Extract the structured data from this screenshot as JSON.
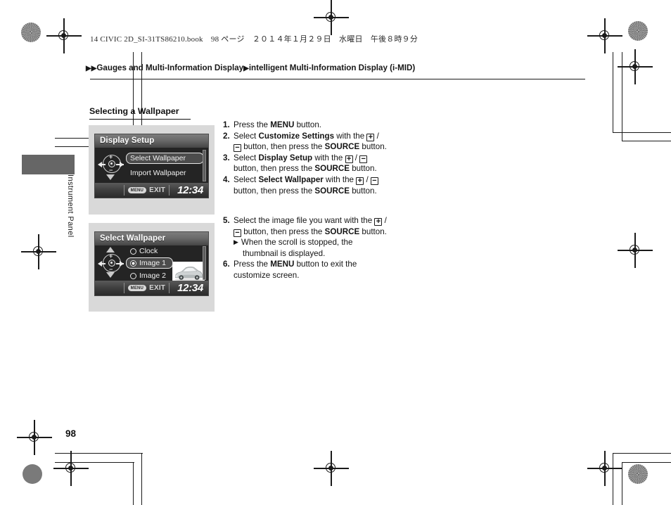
{
  "page": {
    "running_head": "14 CIVIC 2D_SI-31TS86210.book　98 ページ　２０１４年１月２９日　水曜日　午後８時９分",
    "folio": "98",
    "side_tab_label": "Instrument Panel"
  },
  "breadcrumb": {
    "marker": "▶",
    "level1": "Gauges and Multi-Information Display",
    "level2": "intelligent Multi-Information Display (i-MID)"
  },
  "section": {
    "title": "Selecting a Wallpaper"
  },
  "figures": [
    {
      "name": "display-setup-screen",
      "title": "Display Setup",
      "rows": [
        {
          "label": "Select Wallpaper",
          "selected": true,
          "radio": false
        },
        {
          "label": "Import Wallpaper",
          "selected": false,
          "radio": false
        }
      ],
      "statusbar": {
        "menu_key": "MENU",
        "exit_label": "EXIT",
        "clock": "12:34"
      },
      "knob": {
        "plus": "+",
        "minus": "−"
      },
      "has_thumbnail": false,
      "scroll_up": false,
      "scroll_down": true
    },
    {
      "name": "select-wallpaper-screen",
      "title": "Select Wallpaper",
      "rows": [
        {
          "label": "Clock",
          "selected": false,
          "radio": true,
          "radio_on": false
        },
        {
          "label": "Image 1",
          "selected": true,
          "radio": true,
          "radio_on": true
        },
        {
          "label": "Image 2",
          "selected": false,
          "radio": true,
          "radio_on": false
        }
      ],
      "statusbar": {
        "menu_key": "MENU",
        "exit_label": "EXIT",
        "clock": "12:34"
      },
      "knob": {
        "plus": "+",
        "minus": "−"
      },
      "has_thumbnail": true,
      "thumbnail_alt": "car-wallpaper-thumbnail",
      "scroll_up": true,
      "scroll_down": true
    }
  ],
  "procedure_top": [
    {
      "num": "1.",
      "parts": [
        {
          "t": "Press the "
        },
        {
          "t": "MENU",
          "b": true
        },
        {
          "t": " button."
        }
      ]
    },
    {
      "num": "2.",
      "parts": [
        {
          "t": "Select "
        },
        {
          "t": "Customize Settings",
          "b": true
        },
        {
          "t": " with the "
        },
        {
          "k": "+"
        },
        {
          "t": " / "
        }
      ]
    },
    {
      "num": "",
      "parts": [
        {
          "k": "−"
        },
        {
          "t": " button, then press the "
        },
        {
          "t": "SOURCE",
          "b": true
        },
        {
          "t": " button."
        }
      ],
      "indent": true
    },
    {
      "num": "3.",
      "parts": [
        {
          "t": "Select "
        },
        {
          "t": "Display Setup",
          "b": true
        },
        {
          "t": " with the "
        },
        {
          "k": "+"
        },
        {
          "t": " / "
        },
        {
          "k": "−"
        }
      ]
    },
    {
      "num": "",
      "parts": [
        {
          "t": "button, then press the "
        },
        {
          "t": "SOURCE",
          "b": true
        },
        {
          "t": " button."
        }
      ],
      "indent": true
    },
    {
      "num": "4.",
      "parts": [
        {
          "t": "Select "
        },
        {
          "t": "Select Wallpaper",
          "b": true
        },
        {
          "t": " with the "
        },
        {
          "k": "+"
        },
        {
          "t": " / "
        },
        {
          "k": "−"
        }
      ]
    },
    {
      "num": "",
      "parts": [
        {
          "t": "button, then press the "
        },
        {
          "t": "SOURCE",
          "b": true
        },
        {
          "t": " button."
        }
      ],
      "indent": true
    }
  ],
  "procedure_bottom": [
    {
      "num": "5.",
      "parts": [
        {
          "t": "Select the image file you want with the "
        },
        {
          "k": "+"
        },
        {
          "t": " / "
        }
      ]
    },
    {
      "num": "",
      "parts": [
        {
          "k": "−"
        },
        {
          "t": " button, then press the "
        },
        {
          "t": "SOURCE",
          "b": true
        },
        {
          "t": " button."
        }
      ],
      "indent": true
    },
    {
      "num": "",
      "bullet": "▶",
      "parts": [
        {
          "t": "When the scroll is stopped, the"
        }
      ]
    },
    {
      "num": "",
      "parts": [
        {
          "t": "thumbnail is displayed."
        }
      ],
      "indent2": true
    },
    {
      "num": "6.",
      "parts": [
        {
          "t": "Press the "
        },
        {
          "t": "MENU",
          "b": true
        },
        {
          "t": " button to exit the"
        }
      ]
    },
    {
      "num": "",
      "parts": [
        {
          "t": "customize screen."
        }
      ],
      "indent": true
    }
  ],
  "colors": {
    "page_bg": "#ffffff",
    "ink": "#1a1a1a",
    "figure_bg": "#d9d9d9",
    "screen_bg": "#242424",
    "tab_gray": "#666666"
  }
}
